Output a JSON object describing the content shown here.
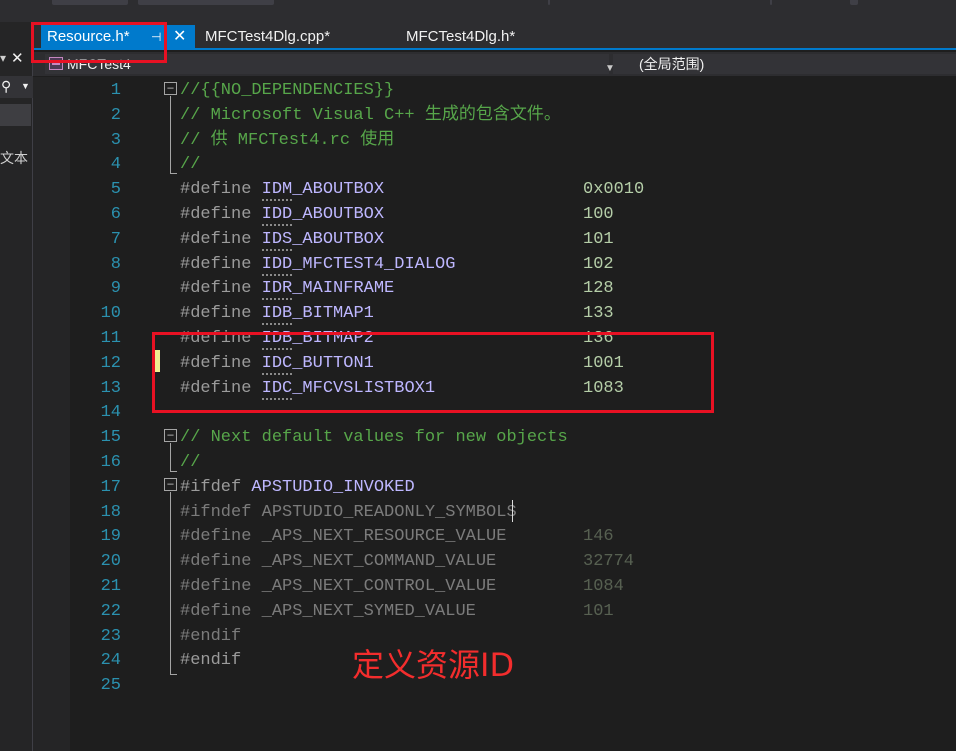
{
  "tabs": [
    {
      "label": "Resource.h*",
      "active": true,
      "pin_icon": "pin-icon",
      "close_icon": "close-icon"
    },
    {
      "label": "MFCTest4Dlg.cpp*",
      "active": false
    },
    {
      "label": "MFCTest4Dlg.h*",
      "active": false
    }
  ],
  "left_panel": {
    "close": "✕",
    "side_text": "文本"
  },
  "navbar": {
    "project": "MFCTest4",
    "scope": "(全局范围)"
  },
  "code_lines": [
    {
      "n": "1",
      "a": "//{{NO_DEPENDENCIES}}"
    },
    {
      "n": "2",
      "a": "// Microsoft Visual C++ 生成的包含文件。"
    },
    {
      "n": "3",
      "a": "// 供 MFCTest4.rc 使用"
    },
    {
      "n": "4",
      "a": "//"
    },
    {
      "n": "5",
      "pp": "#define ",
      "mac": "IDM_ABOUTBOX",
      "val": "0x0010"
    },
    {
      "n": "6",
      "pp": "#define ",
      "mac": "IDD_ABOUTBOX",
      "val": "100"
    },
    {
      "n": "7",
      "pp": "#define ",
      "mac": "IDS_ABOUTBOX",
      "val": "101"
    },
    {
      "n": "8",
      "pp": "#define ",
      "mac": "IDD_MFCTEST4_DIALOG",
      "val": "102"
    },
    {
      "n": "9",
      "pp": "#define ",
      "mac": "IDR_MAINFRAME",
      "val": "128"
    },
    {
      "n": "10",
      "pp": "#define ",
      "mac": "IDB_BITMAP1",
      "val": "133"
    },
    {
      "n": "11",
      "pp": "#define ",
      "mac": "IDB_BITMAP2",
      "val": "136"
    },
    {
      "n": "12",
      "pp": "#define ",
      "mac": "IDC_BUTTON1",
      "val": "1001"
    },
    {
      "n": "13",
      "pp": "#define ",
      "mac": "IDC_MFCVSLISTBOX1",
      "val": "1083"
    },
    {
      "n": "14",
      "a": ""
    },
    {
      "n": "15",
      "a": "// Next default values for new objects"
    },
    {
      "n": "16",
      "a": "//"
    },
    {
      "n": "17",
      "pp": "#ifdef ",
      "mac": "APSTUDIO_INVOKED"
    },
    {
      "n": "18",
      "pp": "#ifndef ",
      "mac": "APSTUDIO_READONLY_SYMBOLS"
    },
    {
      "n": "19",
      "pp": "#define ",
      "mac": "_APS_NEXT_RESOURCE_VALUE",
      "val": "146"
    },
    {
      "n": "20",
      "pp": "#define ",
      "mac": "_APS_NEXT_COMMAND_VALUE",
      "val": "32774"
    },
    {
      "n": "21",
      "pp": "#define ",
      "mac": "_APS_NEXT_CONTROL_VALUE",
      "val": "1084"
    },
    {
      "n": "22",
      "pp": "#define ",
      "mac": "_APS_NEXT_SYMED_VALUE",
      "val": "101"
    },
    {
      "n": "23",
      "pp": "#endif"
    },
    {
      "n": "24",
      "pp": "#endif"
    },
    {
      "n": "25",
      "a": ""
    }
  ],
  "annotation": {
    "label": "定义资源ID",
    "color": "#e81123"
  }
}
